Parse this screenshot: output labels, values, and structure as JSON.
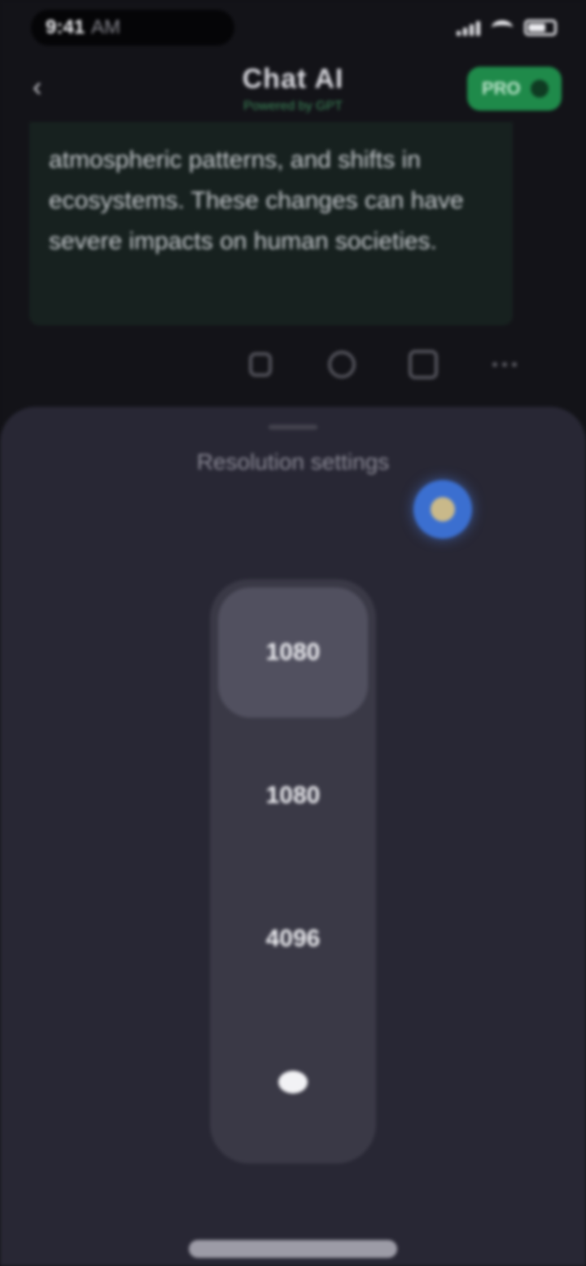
{
  "status_bar": {
    "time": "9:41",
    "carrier": "AM",
    "icons": [
      "signal-icon",
      "wifi-icon",
      "battery-icon"
    ]
  },
  "app_bar": {
    "title": "Chat AI",
    "subtitle": "Powered by GPT",
    "back_icon": "chevron-left-icon",
    "pro_label": "PRO"
  },
  "message": {
    "text": "atmospheric patterns, and shifts in ecosystems. These changes can have severe impacts on human societies."
  },
  "message_actions": [
    "thumbs-up-icon",
    "share-icon",
    "copy-icon",
    "more-icon"
  ],
  "sheet": {
    "title": "Resolution settings",
    "info_icon": "info-icon",
    "options": [
      {
        "label": "1080",
        "selected": true
      },
      {
        "label": "1080",
        "selected": false
      },
      {
        "label": "4096",
        "selected": false
      },
      {
        "label": "",
        "icon": "sun-icon",
        "selected": false
      }
    ]
  },
  "colors": {
    "background": "#131318",
    "sheet": "#282734",
    "picker": "#3a3946",
    "selected": "#51505f",
    "accent_green": "#1f8a4a",
    "accent_blue": "#3b6fd0"
  }
}
